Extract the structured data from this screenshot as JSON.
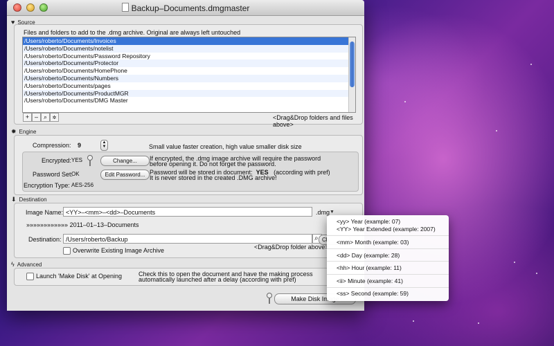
{
  "window": {
    "title": "Backup–Documents.dmgmaster"
  },
  "source": {
    "title": "Source",
    "hint": "Files and folders to add to the .dmg archive. Original are always left untouched",
    "items": [
      "/Users/roberto/Documents/Invoices",
      "/Users/roberto/Documents/notelist",
      "/Users/roberto/Documents/Password Repository",
      "/Users/roberto/Documents/Protector",
      "/Users/roberto/Documents/HomePhone",
      "/Users/roberto/Documents/Numbers",
      "/Users/roberto/Documents/pages",
      "/Users/roberto/Documents/ProductMGR",
      "/Users/roberto/Documents/DMG Master"
    ],
    "selected_index": 0,
    "add_label": "+",
    "remove_label": "–",
    "drag_hint": "<Drag&Drop folders and files above>"
  },
  "engine": {
    "title": "Engine",
    "compression_label": "Compression:",
    "compression_value": "9",
    "compression_hint": "Small value faster creation, high value smaller disk size",
    "encrypted_label": "Encrypted:",
    "encrypted_value": "YES",
    "change_button": "Change...",
    "encrypted_hint_1": "If encrypted, the  .dmg image archive will require the password",
    "encrypted_hint_2": "before opening it. Do not forget the password.",
    "password_label": "Password Set:",
    "password_value": "OK",
    "edit_password_button": "Edit Password...",
    "password_hint_1a": "Password  will be stored in document:",
    "password_hint_1b": "YES",
    "password_hint_1c": "(according with pref)",
    "password_hint_2": "It is never stored  in the created .DMG archive!",
    "encryption_type_label": "Encryption Type:",
    "encryption_type_value": "AES-256"
  },
  "destination": {
    "title": "Destination",
    "image_name_label": "Image Name:",
    "image_name_value": "<YY>–<mm>–<dd>–Documents",
    "extension": ".dmg",
    "preview": "»»»»»»»»»»»» 2011–01–13–Documents",
    "destination_label": "Destination:",
    "destination_value": "/Users/roberto/Backup",
    "choose_button": "Ch",
    "drag_hint": "<Drag&Drop folder above>",
    "overwrite_label": "Overwrite Existing Image Archive"
  },
  "advanced": {
    "title": "Advanced",
    "launch_label": "Launch 'Make Disk' at Opening",
    "hint_1": "Check this to open the document and have the making process",
    "hint_2": "automatically launched after a delay (according with pref)"
  },
  "make_disk_button": "Make Disk Image",
  "token_menu": [
    "<yy>  Year (example: 07)",
    "<YY>  Year Extended (example: 2007)",
    "<mm>  Month (example: 03)",
    "<dd>  Day (example: 28)",
    "<hh>  Hour (example: 11)",
    "<ii>  Minute (example: 41)",
    "<ss>  Second (example: 59)"
  ]
}
